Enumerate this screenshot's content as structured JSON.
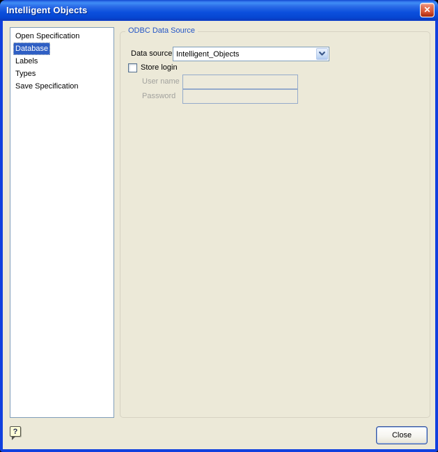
{
  "window": {
    "title": "Intelligent Objects",
    "close_glyph": "✕"
  },
  "sidebar": {
    "items": [
      {
        "label": "Open Specification",
        "selected": false
      },
      {
        "label": "Database",
        "selected": true
      },
      {
        "label": "Labels",
        "selected": false
      },
      {
        "label": "Types",
        "selected": false
      },
      {
        "label": "Save Specification",
        "selected": false
      }
    ]
  },
  "main": {
    "group_title": "ODBC Data Source",
    "data_source_label": "Data source",
    "data_source_value": "Intelligent_Objects",
    "store_login_label": "Store login",
    "store_login_checked": false,
    "user_name_label": "User name",
    "user_name_value": "",
    "password_label": "Password",
    "password_value": ""
  },
  "footer": {
    "help_glyph": "?",
    "close_label": "Close"
  },
  "colors": {
    "dialog_bg": "#ECE9D8",
    "titlebar_blue": "#0C50DD",
    "window_border_blue": "#1140DE",
    "selection_blue": "#2F5FC4",
    "groupbox_caption_blue": "#2355C6",
    "control_border": "#7F9DB9",
    "disabled_text": "#A2A29E",
    "close_button_red": "#D8512E"
  }
}
